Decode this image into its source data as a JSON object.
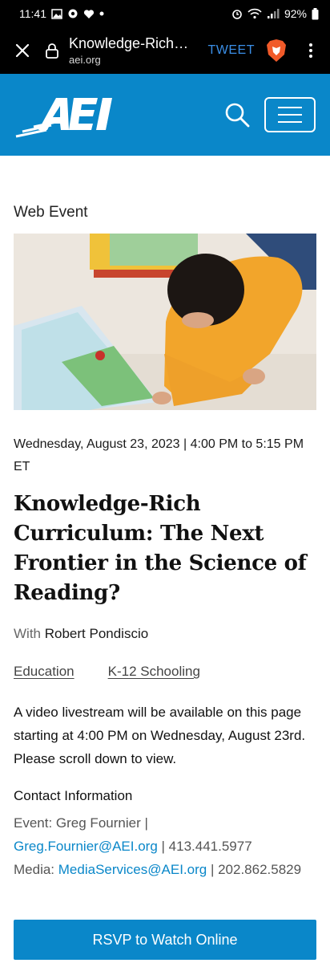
{
  "status_bar": {
    "time": "11:41",
    "battery": "92%",
    "left_icons": [
      "gallery-icon",
      "settings-icon",
      "heart-icon",
      "dot-icon"
    ],
    "right_icons": [
      "alarm-icon",
      "wifi-icon",
      "signal-icon",
      "battery-icon"
    ]
  },
  "browser": {
    "title": "Knowledge-Rich Curriculum: The Next Frontier",
    "url": "aei.org",
    "tweet_label": "TWEET"
  },
  "site_header": {
    "logo_text": "AEI",
    "accent_color": "#0a87c9"
  },
  "event": {
    "eyebrow": "Web Event",
    "date": "Wednesday, August 23, 2023 | 4:00 PM to 5:15 PM ET",
    "title": "Knowledge-Rich Curriculum: The Next Frontier in the Science of Reading?",
    "with_label": "With",
    "speaker": "Robert Pondiscio",
    "tags": [
      "Education",
      "K-12 Schooling"
    ],
    "description": "A video livestream will be available on this page starting at 4:00 PM on Wednesday, August 23rd. Please scroll down to view."
  },
  "contact": {
    "heading": "Contact Information",
    "event_label": "Event: Greg Fournier |",
    "event_email": "Greg.Fournier@AEI.org",
    "event_phone": "| 413.441.5977",
    "media_label": "Media:",
    "media_email": "MediaServices@AEI.org",
    "media_phone": "| 202.862.5829"
  },
  "rsvp_label": "RSVP to Watch Online"
}
